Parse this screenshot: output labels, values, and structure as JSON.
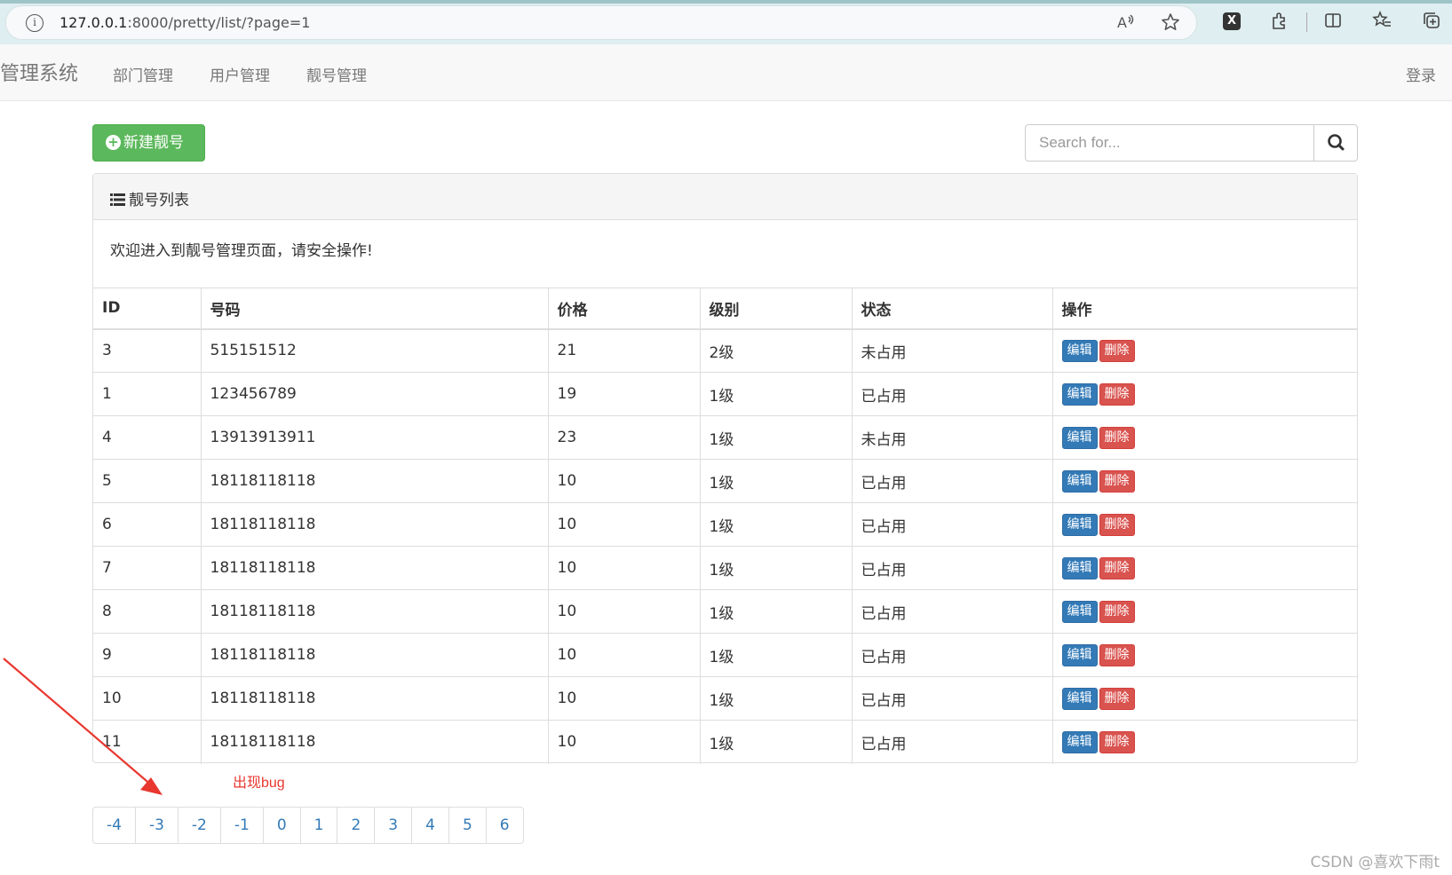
{
  "browser": {
    "url_host": "127.0.0.1",
    "url_rest": ":8000/pretty/list/?page=1",
    "icons": [
      "info-icon",
      "read-aloud-icon",
      "favorite-star-icon",
      "extension-x-icon",
      "extensions-icon",
      "split-screen-icon",
      "favorites-icon",
      "collections-icon"
    ]
  },
  "navbar": {
    "brand": "管理系统",
    "links": [
      "部门管理",
      "用户管理",
      "靓号管理"
    ],
    "login": "登录"
  },
  "actions": {
    "new_button": "新建靓号",
    "search_placeholder": "Search for..."
  },
  "panel": {
    "title": "靓号列表",
    "body": "欢迎进入到靓号管理页面，请安全操作!"
  },
  "table": {
    "headers": [
      "ID",
      "号码",
      "价格",
      "级别",
      "状态",
      "操作"
    ],
    "edit_label": "编辑",
    "delete_label": "删除",
    "rows": [
      {
        "id": "3",
        "mobile": "515151512",
        "price": "21",
        "level": "2级",
        "status": "未占用"
      },
      {
        "id": "1",
        "mobile": "123456789",
        "price": "19",
        "level": "1级",
        "status": "已占用"
      },
      {
        "id": "4",
        "mobile": "13913913911",
        "price": "23",
        "level": "1级",
        "status": "未占用"
      },
      {
        "id": "5",
        "mobile": "18118118118",
        "price": "10",
        "level": "1级",
        "status": "已占用"
      },
      {
        "id": "6",
        "mobile": "18118118118",
        "price": "10",
        "level": "1级",
        "status": "已占用"
      },
      {
        "id": "7",
        "mobile": "18118118118",
        "price": "10",
        "level": "1级",
        "status": "已占用"
      },
      {
        "id": "8",
        "mobile": "18118118118",
        "price": "10",
        "level": "1级",
        "status": "已占用"
      },
      {
        "id": "9",
        "mobile": "18118118118",
        "price": "10",
        "level": "1级",
        "status": "已占用"
      },
      {
        "id": "10",
        "mobile": "18118118118",
        "price": "10",
        "level": "1级",
        "status": "已占用"
      },
      {
        "id": "11",
        "mobile": "18118118118",
        "price": "10",
        "level": "1级",
        "status": "已占用"
      }
    ]
  },
  "annotation": "出现bug",
  "pagination": [
    "-4",
    "-3",
    "-2",
    "-1",
    "0",
    "1",
    "2",
    "3",
    "4",
    "5",
    "6"
  ],
  "watermark": "CSDN @喜欢下雨t",
  "colors": {
    "success": "#5cb85c",
    "primary": "#337ab7",
    "danger": "#d9534f",
    "annotation": "#e8372f"
  }
}
